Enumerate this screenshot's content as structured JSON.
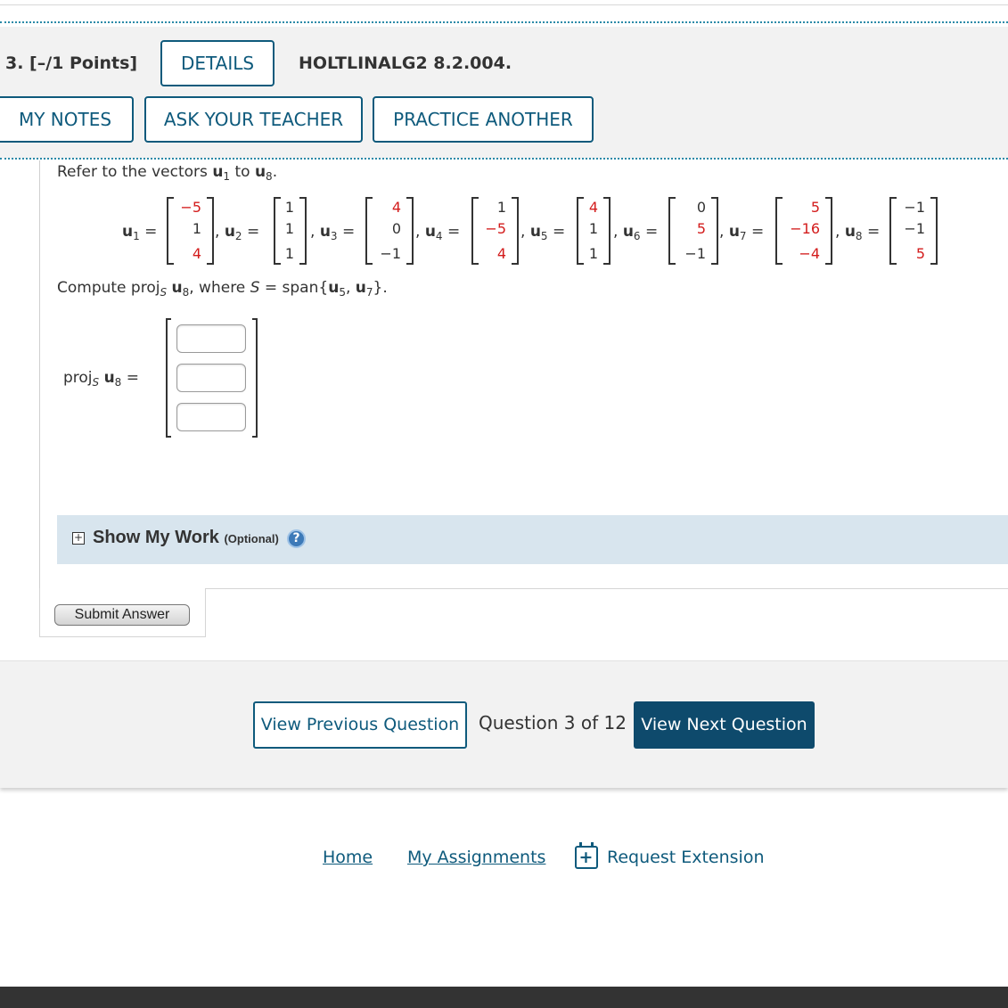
{
  "question": {
    "number_points": "3.  [–/1 Points]",
    "details_label": "DETAILS",
    "code": "HOLTLINALG2 8.2.004.",
    "my_notes_label": "MY NOTES",
    "ask_teacher_label": "ASK YOUR TEACHER",
    "practice_label": "PRACTICE ANOTHER"
  },
  "problem": {
    "intro_prefix": "Refer to the vectors ",
    "intro_mid": " to ",
    "intro_suffix": ".",
    "compute_prefix": "Compute  proj",
    "compute_where": ",  where ",
    "compute_span": " = span{",
    "compute_end": "}.",
    "proj_label": "proj",
    "equals": "=",
    "u": "u",
    "S": "S"
  },
  "vectors": [
    {
      "name": "u",
      "sub": "1",
      "values": [
        "−5",
        "1",
        "4"
      ],
      "red": [
        true,
        false,
        true
      ]
    },
    {
      "name": "u",
      "sub": "2",
      "values": [
        "1",
        "1",
        "1"
      ],
      "red": [
        false,
        false,
        false
      ]
    },
    {
      "name": "u",
      "sub": "3",
      "values": [
        "4",
        "0",
        "−1"
      ],
      "red": [
        true,
        false,
        false
      ]
    },
    {
      "name": "u",
      "sub": "4",
      "values": [
        "1",
        "−5",
        "4"
      ],
      "red": [
        false,
        true,
        true
      ]
    },
    {
      "name": "u",
      "sub": "5",
      "values": [
        "4",
        "1",
        "1"
      ],
      "red": [
        true,
        false,
        false
      ]
    },
    {
      "name": "u",
      "sub": "6",
      "values": [
        "0",
        "5",
        "−1"
      ],
      "red": [
        false,
        true,
        false
      ]
    },
    {
      "name": "u",
      "sub": "7",
      "values": [
        "5",
        "−16",
        "−4"
      ],
      "red": [
        true,
        true,
        true
      ]
    },
    {
      "name": "u",
      "sub": "8",
      "values": [
        "−1",
        "−1",
        "5"
      ],
      "red": [
        false,
        false,
        true
      ]
    }
  ],
  "answer": {
    "inputs": [
      "",
      "",
      ""
    ]
  },
  "show_work": {
    "title": "Show My Work",
    "optional": "(Optional)",
    "plus": "+",
    "help": "?"
  },
  "submit_label": "Submit Answer",
  "nav": {
    "prev_label": "View Previous Question",
    "count_label": "Question 3 of 12",
    "next_label": "View Next Question"
  },
  "footer_links": {
    "home": "Home",
    "assignments": "My Assignments",
    "extension": "Request Extension",
    "extension_icon": "calendar-plus-icon"
  },
  "colors": {
    "accent": "#0e5a7c",
    "red_value": "#d31c1c",
    "show_work_bg": "#d8e5ee"
  }
}
